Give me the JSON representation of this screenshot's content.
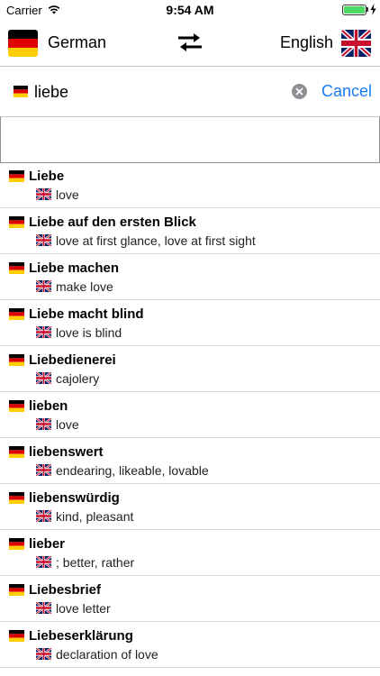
{
  "status_bar": {
    "carrier": "Carrier",
    "time": "9:54 AM",
    "battery_level": 1.0
  },
  "languages": {
    "source": "German",
    "target": "English",
    "swap_icon": "swap-arrows-icon"
  },
  "search": {
    "query": "liebe",
    "placeholder": "",
    "cancel_label": "Cancel"
  },
  "colors": {
    "accent": "#1a7cf5",
    "de_black": "#000000",
    "de_red": "#dd0000",
    "de_gold": "#ffce00",
    "uk_blue": "#012169",
    "uk_red": "#c8102e"
  },
  "results": [
    {
      "de": "Liebe",
      "en": "love"
    },
    {
      "de": "Liebe auf den ersten Blick",
      "en": "love at first glance, love at first sight"
    },
    {
      "de": "Liebe machen",
      "en": "make love"
    },
    {
      "de": "Liebe macht blind",
      "en": "love is blind"
    },
    {
      "de": "Liebedienerei",
      "en": "cajolery"
    },
    {
      "de": "lieben",
      "en": "love"
    },
    {
      "de": "liebenswert",
      "en": "endearing, likeable, lovable"
    },
    {
      "de": "liebenswürdig",
      "en": "kind, pleasant"
    },
    {
      "de": "lieber",
      "en": "; better, rather"
    },
    {
      "de": "Liebesbrief",
      "en": "love letter"
    },
    {
      "de": "Liebeserklärung",
      "en": "declaration of love"
    }
  ]
}
